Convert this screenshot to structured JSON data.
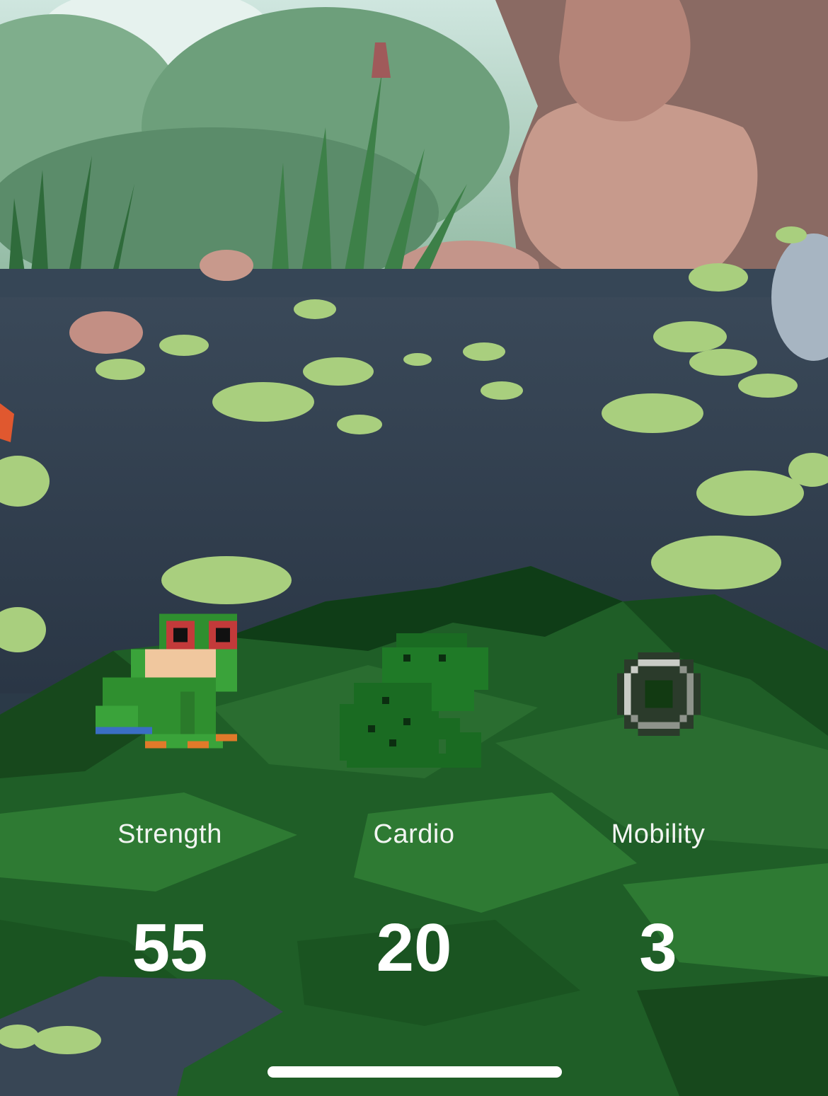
{
  "stats": [
    {
      "label": "Strength",
      "value": "55",
      "icon": "tree-frog-icon"
    },
    {
      "label": "Cardio",
      "value": "20",
      "icon": "toad-icon"
    },
    {
      "label": "Mobility",
      "value": "3",
      "icon": "frog-egg-icon"
    }
  ],
  "colors": {
    "water": "#2f3d4c",
    "lily_pad": "#a9cf7e",
    "rock": "#c89b8e",
    "grass_dark": "#0f3d17",
    "grass_mid": "#1f5e27",
    "grass_light": "#2e7a33",
    "text": "#ffffff"
  }
}
